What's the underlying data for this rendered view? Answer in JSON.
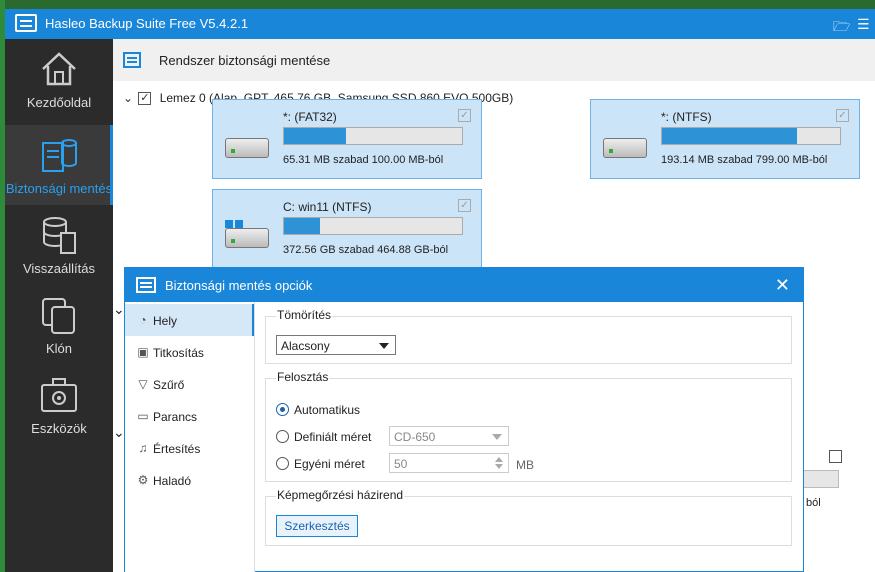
{
  "app": {
    "title": "Hasleo Backup Suite Free V5.4.2.1"
  },
  "sidebar": {
    "items": [
      {
        "label": "Kezdőoldal",
        "icon": "home-icon"
      },
      {
        "label": "Biztonsági mentés",
        "icon": "backup-icon"
      },
      {
        "label": "Visszaállítás",
        "icon": "restore-icon"
      },
      {
        "label": "Klón",
        "icon": "clone-icon"
      },
      {
        "label": "Eszközök",
        "icon": "tools-icon"
      }
    ]
  },
  "header": {
    "title": "Rendszer biztonsági mentése"
  },
  "disk": {
    "label": "Lemez 0 (Alap, GPT, 465.76 GB,  Samsung SSD 860 EVO 500GB)"
  },
  "partitions": [
    {
      "name": "*: (FAT32)",
      "free": "65.31 MB szabad 100.00 MB-ból",
      "used_fraction": 0.35
    },
    {
      "name": "*: (NTFS)",
      "free": "193.14 MB szabad 799.00 MB-ból",
      "used_fraction": 0.76
    },
    {
      "name": "C: win11 (NTFS)",
      "free": "372.56 GB szabad 464.88 GB-ból",
      "used_fraction": 0.2
    }
  ],
  "behind": {
    "fragment": "ból"
  },
  "dialog": {
    "title": "Biztonsági mentés opciók",
    "close": "✕",
    "nav": [
      {
        "label": "Hely",
        "icon": "location-icon"
      },
      {
        "label": "Titkosítás",
        "icon": "lock-icon"
      },
      {
        "label": "Szűrő",
        "icon": "filter-icon"
      },
      {
        "label": "Parancs",
        "icon": "command-icon"
      },
      {
        "label": "Értesítés",
        "icon": "bell-icon"
      },
      {
        "label": "Haladó",
        "icon": "gear-icon"
      }
    ],
    "compression": {
      "title": "Tömörítés",
      "value": "Alacsony"
    },
    "split": {
      "title": "Felosztás",
      "auto": "Automatikus",
      "defined": "Definiált méret",
      "defined_value": "CD-650",
      "custom": "Egyéni méret",
      "custom_value": "50",
      "unit": "MB"
    },
    "retention": {
      "title": "Képmegőrzési házirend",
      "button": "Szerkesztés"
    }
  }
}
